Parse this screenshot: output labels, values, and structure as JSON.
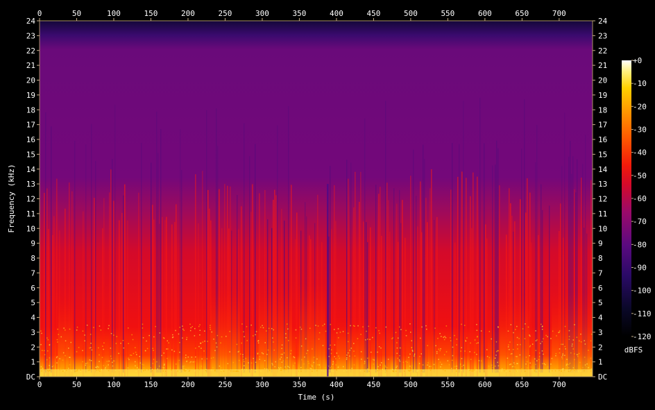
{
  "chart_data": {
    "type": "heatmap",
    "title": "",
    "xlabel": "Time (s)",
    "ylabel": "Frequency (kHz)",
    "xlim": [
      0,
      745
    ],
    "ylim": [
      0,
      24
    ],
    "x_ticks": [
      "0",
      "50",
      "100",
      "150",
      "200",
      "250",
      "300",
      "350",
      "400",
      "450",
      "500",
      "550",
      "600",
      "650",
      "700"
    ],
    "x_tick_values": [
      0,
      50,
      100,
      150,
      200,
      250,
      300,
      350,
      400,
      450,
      500,
      550,
      600,
      650,
      700
    ],
    "y_ticks": [
      "DC",
      "1",
      "2",
      "3",
      "4",
      "5",
      "6",
      "7",
      "8",
      "9",
      "10",
      "11",
      "12",
      "13",
      "14",
      "15",
      "16",
      "17",
      "18",
      "19",
      "20",
      "21",
      "22",
      "23",
      "24"
    ],
    "y_tick_values": [
      0,
      1,
      2,
      3,
      4,
      5,
      6,
      7,
      8,
      9,
      10,
      11,
      12,
      13,
      14,
      15,
      16,
      17,
      18,
      19,
      20,
      21,
      22,
      23,
      24
    ],
    "colorbar": {
      "label": "dBFS",
      "range": [
        -120,
        0
      ],
      "ticks": [
        "+0",
        "-10",
        "-20",
        "-30",
        "-40",
        "-50",
        "-60",
        "-70",
        "-80",
        "-90",
        "-100",
        "-110",
        "-120"
      ],
      "tick_values": [
        0,
        -10,
        -20,
        -30,
        -40,
        -50,
        -60,
        -70,
        -80,
        -90,
        -100,
        -110,
        -120
      ],
      "colors": [
        "#000000",
        "#1a0a50",
        "#3c0a78",
        "#6a0a7a",
        "#a00a60",
        "#d40a2a",
        "#f21a0a",
        "#ff5a00",
        "#ff9a00",
        "#ffd000",
        "#fff060",
        "#ffffff"
      ]
    },
    "approx_levels": [
      {
        "freq_khz": [
          0,
          1
        ],
        "level_dbfs": -25
      },
      {
        "freq_khz": [
          1,
          4
        ],
        "level_dbfs": -45
      },
      {
        "freq_khz": [
          4,
          9
        ],
        "level_dbfs": -55
      },
      {
        "freq_khz": [
          9,
          13
        ],
        "level_dbfs": -65
      },
      {
        "freq_khz": [
          13,
          22.5
        ],
        "level_dbfs": -78
      },
      {
        "freq_khz": [
          22.5,
          24
        ],
        "level_dbfs": -100
      }
    ],
    "grid": false
  }
}
